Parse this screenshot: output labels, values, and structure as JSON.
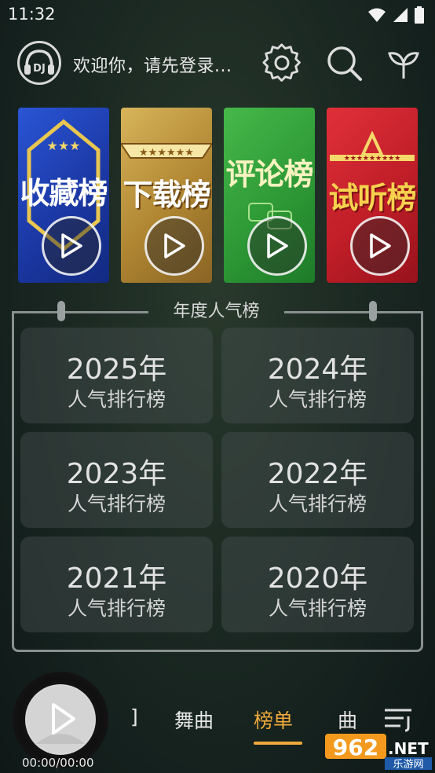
{
  "status_bar": {
    "time": "11:32"
  },
  "header": {
    "avatar_label": "DJ",
    "welcome_text": "欢迎你，请先登录..."
  },
  "cards": [
    {
      "title": "收藏榜",
      "color": "#1f46b8"
    },
    {
      "title": "下载榜",
      "color": "#c09a3e"
    },
    {
      "title": "评论榜",
      "color": "#2e9a3a"
    },
    {
      "title": "试听榜",
      "color": "#c4202a"
    }
  ],
  "annual": {
    "title": "年度人气榜",
    "items": [
      {
        "year": "2025年",
        "sub": "人气排行榜"
      },
      {
        "year": "2024年",
        "sub": "人气排行榜"
      },
      {
        "year": "2023年",
        "sub": "人气排行榜"
      },
      {
        "year": "2022年",
        "sub": "人气排行榜"
      },
      {
        "year": "2021年",
        "sub": "人气排行榜"
      },
      {
        "year": "2020年",
        "sub": "人气排行榜"
      }
    ]
  },
  "bottom": {
    "time": "00:00/00:00",
    "tabs": [
      "]",
      "舞曲",
      "榜单",
      "曲"
    ],
    "active_tab": "榜单"
  },
  "watermark": {
    "number": "962",
    "suffix": ".NET",
    "sub": "乐游网"
  },
  "colors": {
    "accent": "#f0a93a"
  }
}
